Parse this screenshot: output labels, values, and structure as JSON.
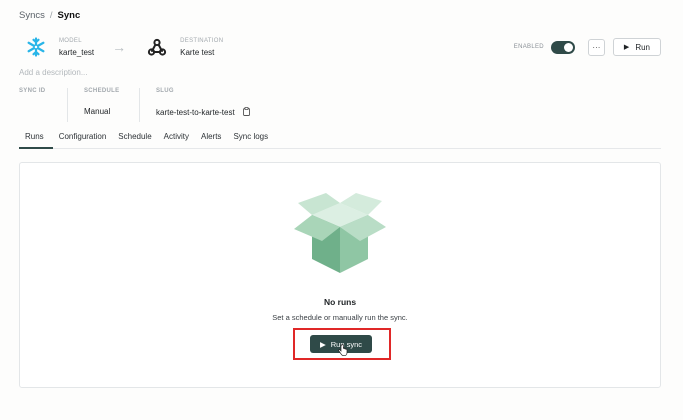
{
  "breadcrumb": {
    "parent": "Syncs",
    "separator": "/",
    "current": "Sync"
  },
  "model": {
    "label": "MODEL",
    "name": "karte_test",
    "icon": "snowflake-icon"
  },
  "destination": {
    "label": "DESTINATION",
    "name": "Karte test",
    "icon": "webhook-icon"
  },
  "controls": {
    "enabled_label": "ENABLED",
    "enabled": true,
    "more_label": "···",
    "run_label": "Run"
  },
  "description_placeholder": "Add a description...",
  "meta": {
    "sync_id_label": "SYNC ID",
    "sync_id_value": "",
    "schedule_label": "SCHEDULE",
    "schedule_value": "Manual",
    "slug_label": "SLUG",
    "slug_value": "karte-test-to-karte-test"
  },
  "tabs": [
    "Runs",
    "Configuration",
    "Schedule",
    "Activity",
    "Alerts",
    "Sync logs"
  ],
  "active_tab": "Runs",
  "empty_state": {
    "title": "No runs",
    "subtitle": "Set a schedule or manually run the sync.",
    "button_label": "Run sync",
    "illustration": "open-box-icon"
  },
  "colors": {
    "accent": "#2f4a48",
    "highlight": "#e02828",
    "box_green": "#8fc6a4"
  }
}
